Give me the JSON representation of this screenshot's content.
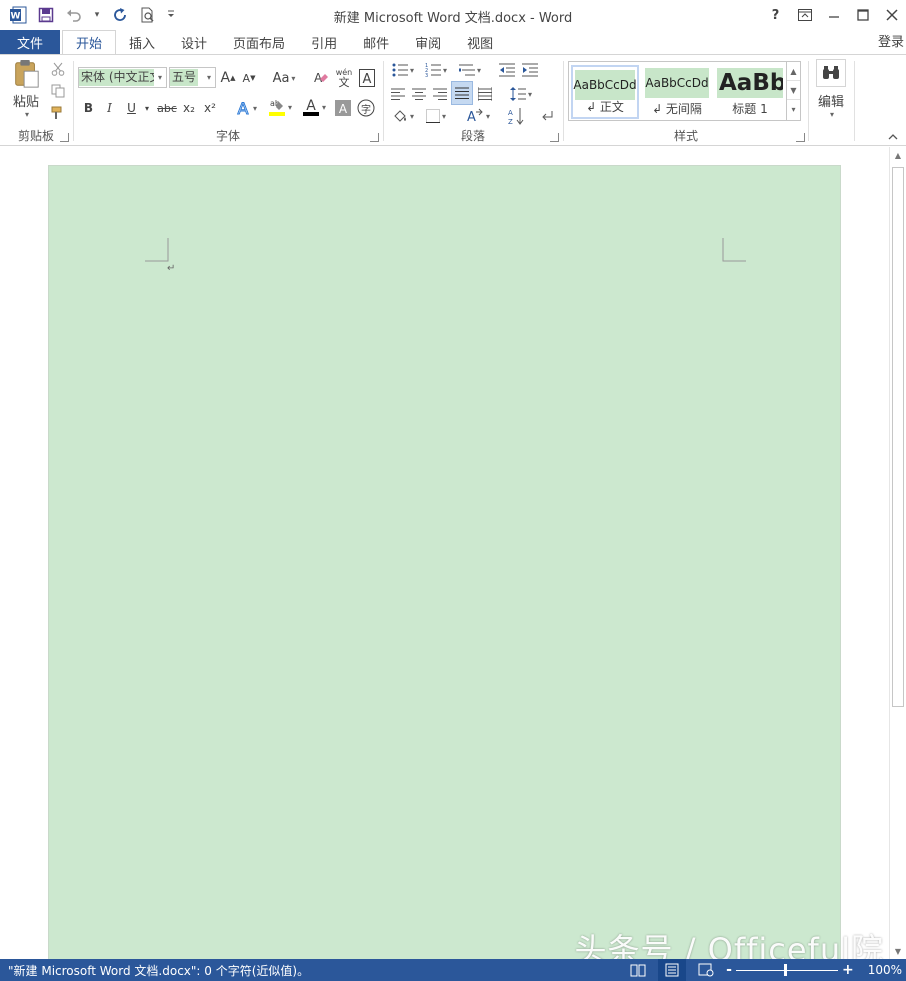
{
  "title_bar": {
    "title": "新建 Microsoft Word 文档.docx - Word",
    "help": "?",
    "minimize": "—",
    "close": "✕"
  },
  "tabs": {
    "file": "文件",
    "items": [
      "开始",
      "插入",
      "设计",
      "页面布局",
      "引用",
      "邮件",
      "审阅",
      "视图"
    ],
    "active": "开始",
    "signin": "登录"
  },
  "clipboard": {
    "paste_label": "粘贴",
    "group_label": "剪贴板"
  },
  "font": {
    "font_name": "宋体 (中文正文)",
    "font_size": "五号",
    "bold": "B",
    "italic": "I",
    "underline": "U",
    "strike": "abc",
    "sub": "x₂",
    "sup": "x²",
    "change_case": "Aa",
    "grow": "A",
    "shrink": "A",
    "phonetic_top": "wén",
    "phonetic_bottom": "文",
    "enclose": "字",
    "group_label": "字体"
  },
  "paragraph": {
    "group_label": "段落"
  },
  "styles": {
    "items": [
      {
        "preview": "AaBbCcDd",
        "name": "↲ 正文"
      },
      {
        "preview": "AaBbCcDd",
        "name": "↲ 无间隔"
      },
      {
        "preview": "AaBb",
        "name": "标题 1"
      }
    ],
    "group_label": "样式"
  },
  "editing": {
    "label": "编辑"
  },
  "document": {
    "paragraph_mark": "↵"
  },
  "status_bar": {
    "text": "\"新建 Microsoft Word 文档.docx\": 0 个字符(近似值)。",
    "zoom_minus": "-",
    "zoom_plus": "+",
    "zoom_level": "100%"
  },
  "watermark": "头条号 / Officeful院",
  "colors": {
    "accent": "#2b579a",
    "page_background": "#cce8cf",
    "highlight": "#c8e6c9"
  }
}
